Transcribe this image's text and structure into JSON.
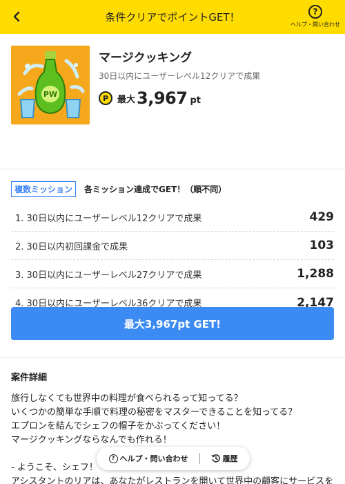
{
  "header": {
    "title": "条件クリアでポイントGET！",
    "help_label": "ヘルプ・問い合わせ"
  },
  "app": {
    "name": "マージクッキング",
    "condition": "30日以内にユーザーレベル12クリアで成果",
    "reward_prefix": "最大",
    "reward_value": "3,967",
    "reward_unit": "pt",
    "coin_letter": "P"
  },
  "mission": {
    "badge": "複数ミッション",
    "description": "各ミッション達成でGET！（順不同）",
    "items": [
      {
        "label": "1. 30日以内にユーザーレベル12クリアで成果",
        "points": "429"
      },
      {
        "label": "2. 30日以内初回課金で成果",
        "points": "103"
      },
      {
        "label": "3. 30日以内にユーザーレベル27クリアで成果",
        "points": "1,288"
      },
      {
        "label": "4. 30日以内にユーザーレベル36クリアで成果",
        "points": "2,147"
      }
    ]
  },
  "cta": {
    "label": "最大3,967pt GET!"
  },
  "detail": {
    "title": "案件詳細",
    "lines": [
      "旅行しなくても世界中の料理が食べられるって知ってる？",
      "いくつかの簡単な手順で料理の秘密をマスターできることを知ってる？",
      "エプロンを結んでシェフの帽子をかぶってください！",
      "マージクッキングならなんでも作れる！",
      "",
      "- ようこそ、シェフ！",
      "アシスタントのリアは、あなたがレストランを開いて世界中の顧客にサービスを"
    ]
  },
  "float_bar": {
    "help": "ヘルプ・問い合わせ",
    "history": "履歴"
  },
  "colors": {
    "header_bg": "#ffdc00",
    "accent_blue": "#3b8bf2",
    "app_icon_bg": "#f5a81c"
  }
}
